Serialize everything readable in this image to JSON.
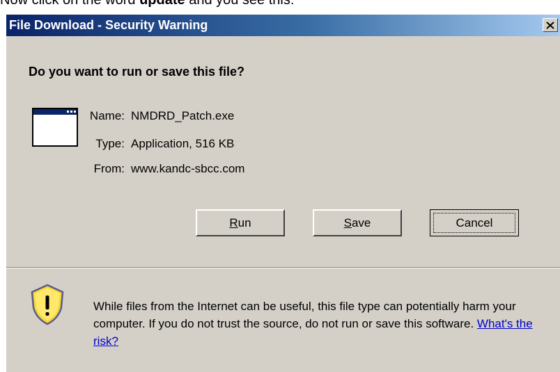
{
  "caption": {
    "text_before": "Now click on the word ",
    "bold_word": "update",
    "text_after": " and you see this:"
  },
  "dialog": {
    "title": "File Download - Security Warning",
    "close_glyph": "✕",
    "question": "Do you want to run or save this file?",
    "icon": "application-window-icon",
    "fields": [
      {
        "label": "Name:",
        "value": "NMDRD_Patch.exe"
      },
      {
        "label": "Type:",
        "value": "Application, 516 KB"
      },
      {
        "label": "From:",
        "value": "www.kandc-sbcc.com"
      }
    ],
    "buttons": {
      "run": {
        "mnemonic": "R",
        "rest": "un"
      },
      "save": {
        "mnemonic": "S",
        "rest": "ave"
      },
      "cancel": "Cancel"
    },
    "warning": {
      "icon": "shield-warning-icon",
      "text": "While files from the Internet can be useful, this file type can potentially harm your computer. If you do not trust the source, do not run or save this software. ",
      "link": "What's the risk?"
    },
    "colors": {
      "title_gradient_start": "#0a246a",
      "title_gradient_end": "#a6caf0",
      "face": "#d4d0c8",
      "link": "#0000cc"
    }
  }
}
